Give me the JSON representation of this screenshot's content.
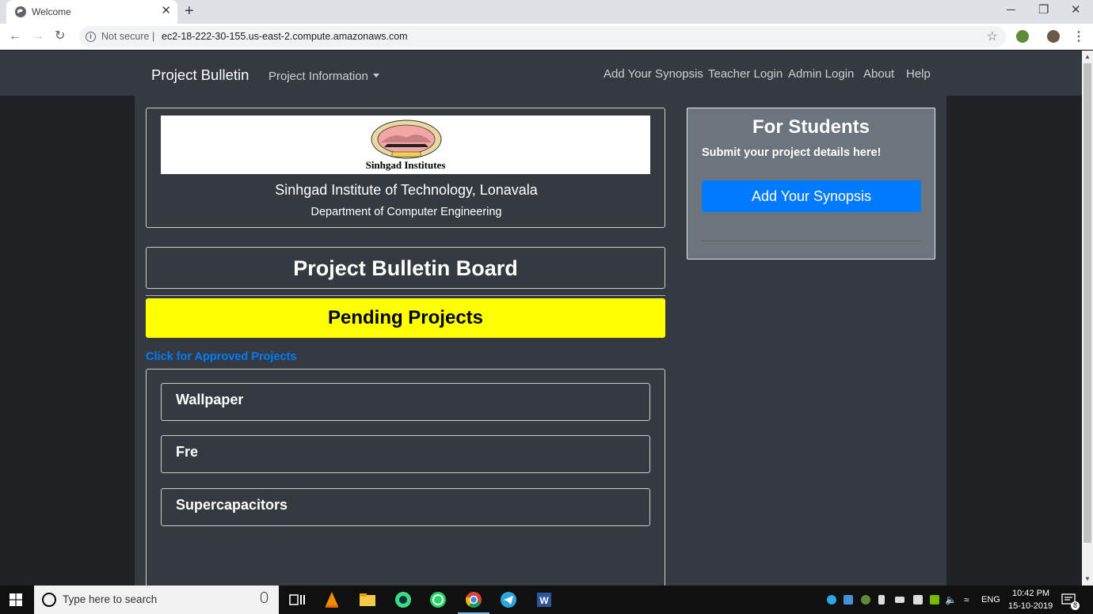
{
  "browser": {
    "tab_title": "Welcome",
    "tab_close": "✕",
    "new_tab": "+",
    "security_label": "Not secure",
    "separator": "|",
    "url": "ec2-18-222-30-155.us-east-2.compute.amazonaws.com"
  },
  "navbar": {
    "brand": "Project Bulletin",
    "dropdown_label": "Project Information",
    "links": [
      "Add Your Synopsis",
      "Teacher Login",
      "Admin Login",
      "About",
      "Help"
    ]
  },
  "header_card": {
    "logo_text": "Sinhgad Institutes",
    "institute": "Sinhgad Institute of Technology, Lonavala",
    "department": "Department of Computer Engineering"
  },
  "board": {
    "title": "Project Bulletin Board",
    "status": "Pending Projects",
    "approved_link": "Click for Approved Projects",
    "projects": [
      "Wallpaper",
      "Fre",
      "Supercapacitors"
    ]
  },
  "student_card": {
    "title": "For Students",
    "subtitle": "Submit your project details here!",
    "button": "Add Your Synopsis"
  },
  "taskbar": {
    "search_placeholder": "Type here to search",
    "language": "ENG",
    "time": "10:42 PM",
    "date": "15-10-2019",
    "notification_count": "8"
  },
  "colors": {
    "navbar_bg": "#343a40",
    "pending_bg": "#ffff00",
    "primary": "#007bff",
    "card_bg": "#6c757d"
  }
}
